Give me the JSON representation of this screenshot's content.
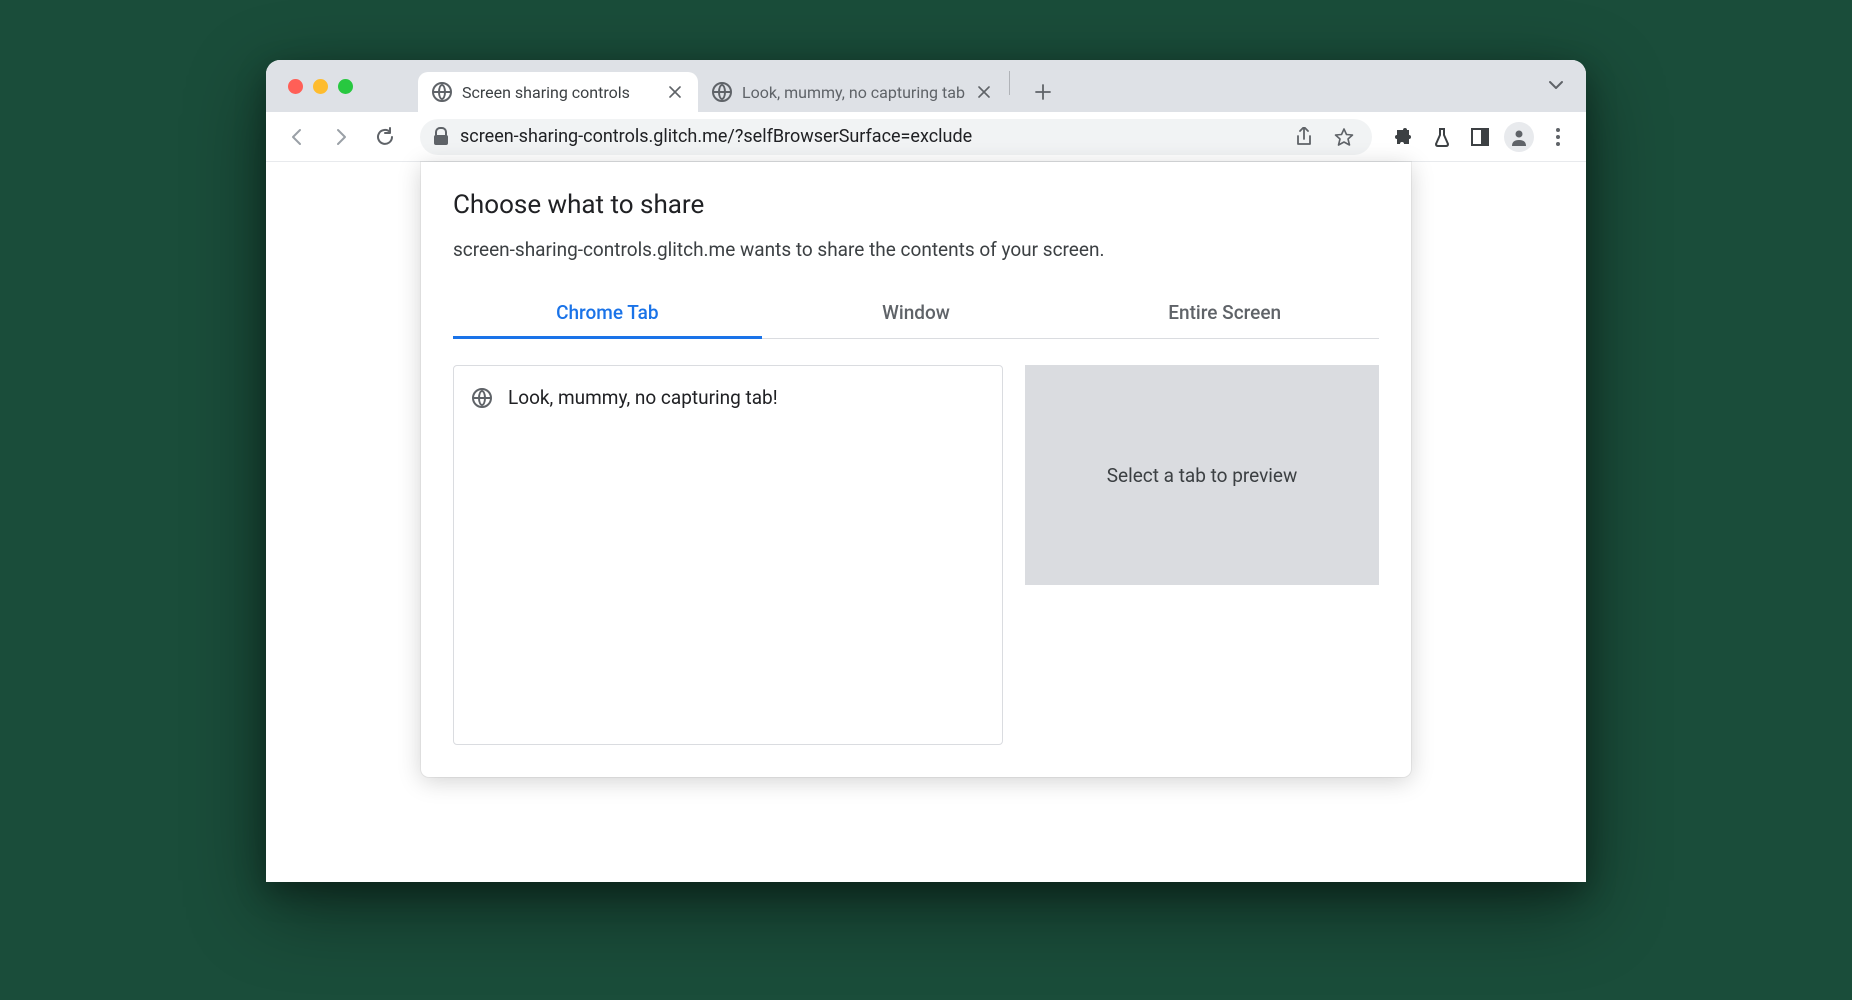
{
  "browser": {
    "tabs": [
      {
        "title": "Screen sharing controls",
        "active": true
      },
      {
        "title": "Look, mummy, no capturing tab",
        "active": false
      }
    ],
    "url": "screen-sharing-controls.glitch.me/?selfBrowserSurface=exclude"
  },
  "dialog": {
    "title": "Choose what to share",
    "subtitle": "screen-sharing-controls.glitch.me wants to share the contents of your screen.",
    "tabs": [
      {
        "label": "Chrome Tab",
        "active": true
      },
      {
        "label": "Window",
        "active": false
      },
      {
        "label": "Entire Screen",
        "active": false
      }
    ],
    "tab_list": [
      {
        "label": "Look, mummy, no capturing tab!"
      }
    ],
    "preview_placeholder": "Select a tab to preview"
  }
}
